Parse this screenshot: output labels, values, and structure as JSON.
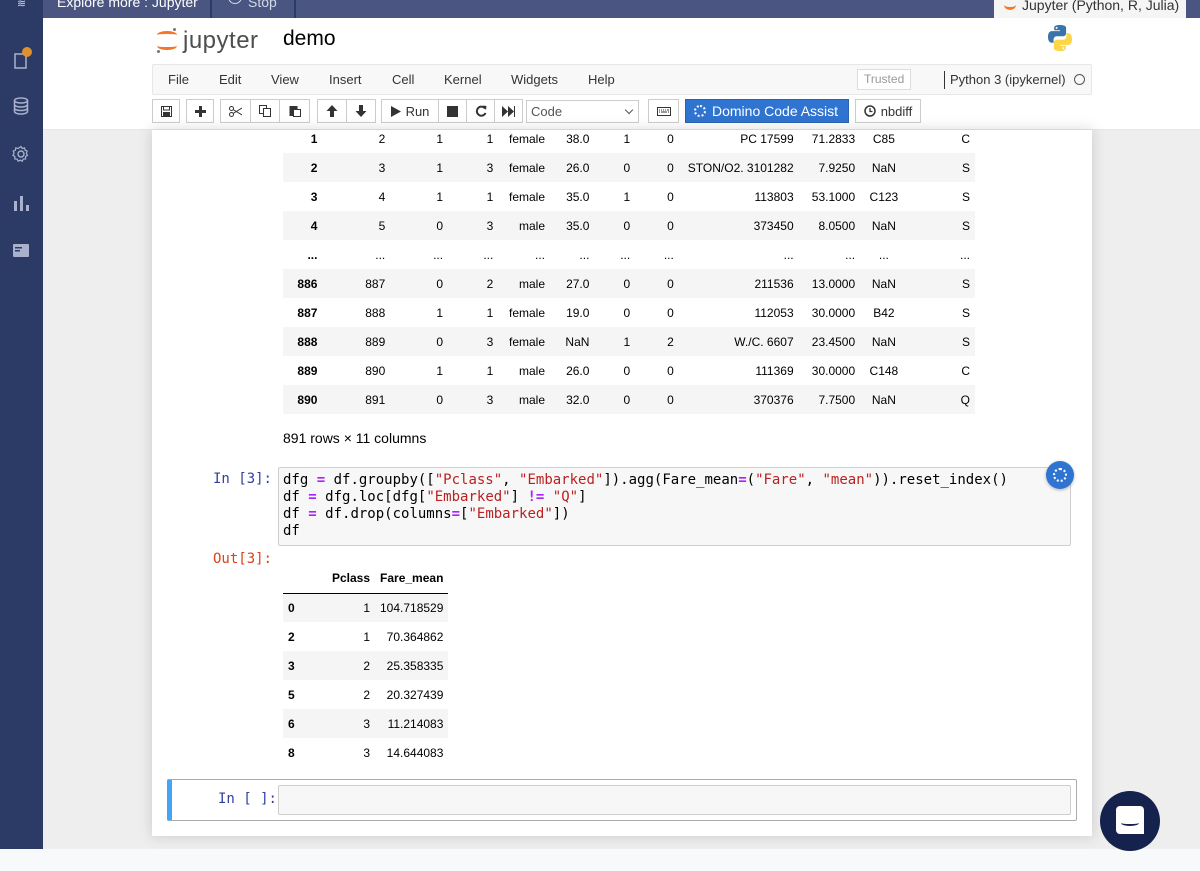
{
  "browser_tabs": [
    {
      "label": "Explore more : Jupyter"
    },
    {
      "label": "Stop"
    },
    {
      "label": "Jupyter (Python, R, Julia)"
    }
  ],
  "sidebar": {
    "items": [
      {
        "icon": "file-icon",
        "has_notification": true
      },
      {
        "icon": "database-icon"
      },
      {
        "icon": "gear-icon"
      },
      {
        "icon": "bar-chart-icon"
      },
      {
        "icon": "panel-icon"
      }
    ]
  },
  "header": {
    "logo_text": "jupyter",
    "notebook_name": "demo",
    "kernel_logo": "python-logo-icon"
  },
  "menu": {
    "items": [
      "File",
      "Edit",
      "View",
      "Insert",
      "Cell",
      "Kernel",
      "Widgets",
      "Help"
    ],
    "trusted_label": "Trusted",
    "kernel_name": "Python 3 (ipykernel)"
  },
  "toolbar": {
    "run_label": "Run",
    "cell_type": "Code",
    "domino_label": "Domino Code Assist",
    "nbdiff_label": "nbdiff"
  },
  "output1": {
    "rows": [
      {
        "idx": "1",
        "cells": [
          "2",
          "1",
          "1",
          "female",
          "38.0",
          "1",
          "0",
          "PC 17599",
          "71.2833",
          "C85",
          "C"
        ]
      },
      {
        "idx": "2",
        "cells": [
          "3",
          "1",
          "3",
          "female",
          "26.0",
          "0",
          "0",
          "STON/O2. 3101282",
          "7.9250",
          "NaN",
          "S"
        ]
      },
      {
        "idx": "3",
        "cells": [
          "4",
          "1",
          "1",
          "female",
          "35.0",
          "1",
          "0",
          "113803",
          "53.1000",
          "C123",
          "S"
        ]
      },
      {
        "idx": "4",
        "cells": [
          "5",
          "0",
          "3",
          "male",
          "35.0",
          "0",
          "0",
          "373450",
          "8.0500",
          "NaN",
          "S"
        ]
      },
      {
        "idx": "...",
        "cells": [
          "...",
          "...",
          "...",
          "...",
          "...",
          "...",
          "...",
          "...",
          "...",
          "...",
          "..."
        ]
      },
      {
        "idx": "886",
        "cells": [
          "887",
          "0",
          "2",
          "male",
          "27.0",
          "0",
          "0",
          "211536",
          "13.0000",
          "NaN",
          "S"
        ]
      },
      {
        "idx": "887",
        "cells": [
          "888",
          "1",
          "1",
          "female",
          "19.0",
          "0",
          "0",
          "112053",
          "30.0000",
          "B42",
          "S"
        ]
      },
      {
        "idx": "888",
        "cells": [
          "889",
          "0",
          "3",
          "female",
          "NaN",
          "1",
          "2",
          "W./C. 6607",
          "23.4500",
          "NaN",
          "S"
        ]
      },
      {
        "idx": "889",
        "cells": [
          "890",
          "1",
          "1",
          "male",
          "26.0",
          "0",
          "0",
          "111369",
          "30.0000",
          "C148",
          "C"
        ]
      },
      {
        "idx": "890",
        "cells": [
          "891",
          "0",
          "3",
          "male",
          "32.0",
          "0",
          "0",
          "370376",
          "7.7500",
          "NaN",
          "Q"
        ]
      }
    ],
    "shape_text": "891 rows × 11 columns"
  },
  "cell3": {
    "in_prompt": "In [3]:",
    "out_prompt": "Out[3]:",
    "code_lines": [
      "dfg = df.groupby([\"Pclass\", \"Embarked\"]).agg(Fare_mean=(\"Fare\", \"mean\")).reset_index()",
      "df = dfg.loc[dfg[\"Embarked\"] != \"Q\"]",
      "df = df.drop(columns=[\"Embarked\"])",
      "df"
    ],
    "output_table": {
      "columns": [
        "",
        "Pclass",
        "Fare_mean"
      ],
      "rows": [
        {
          "idx": "0",
          "Pclass": "1",
          "Fare_mean": "104.718529"
        },
        {
          "idx": "2",
          "Pclass": "1",
          "Fare_mean": "70.364862"
        },
        {
          "idx": "3",
          "Pclass": "2",
          "Fare_mean": "25.358335"
        },
        {
          "idx": "5",
          "Pclass": "2",
          "Fare_mean": "20.327439"
        },
        {
          "idx": "6",
          "Pclass": "3",
          "Fare_mean": "11.214083"
        },
        {
          "idx": "8",
          "Pclass": "3",
          "Fare_mean": "14.644083"
        }
      ]
    }
  },
  "empty_cell": {
    "in_prompt": "In [ ]:",
    "value": ""
  },
  "colors": {
    "sidebar_bg": "#2c3a66",
    "accent_blue": "#2f74d0",
    "selected_cell_bar": "#42a5f5",
    "jupyter_orange": "#f37726",
    "chat_button": "#16224e"
  }
}
